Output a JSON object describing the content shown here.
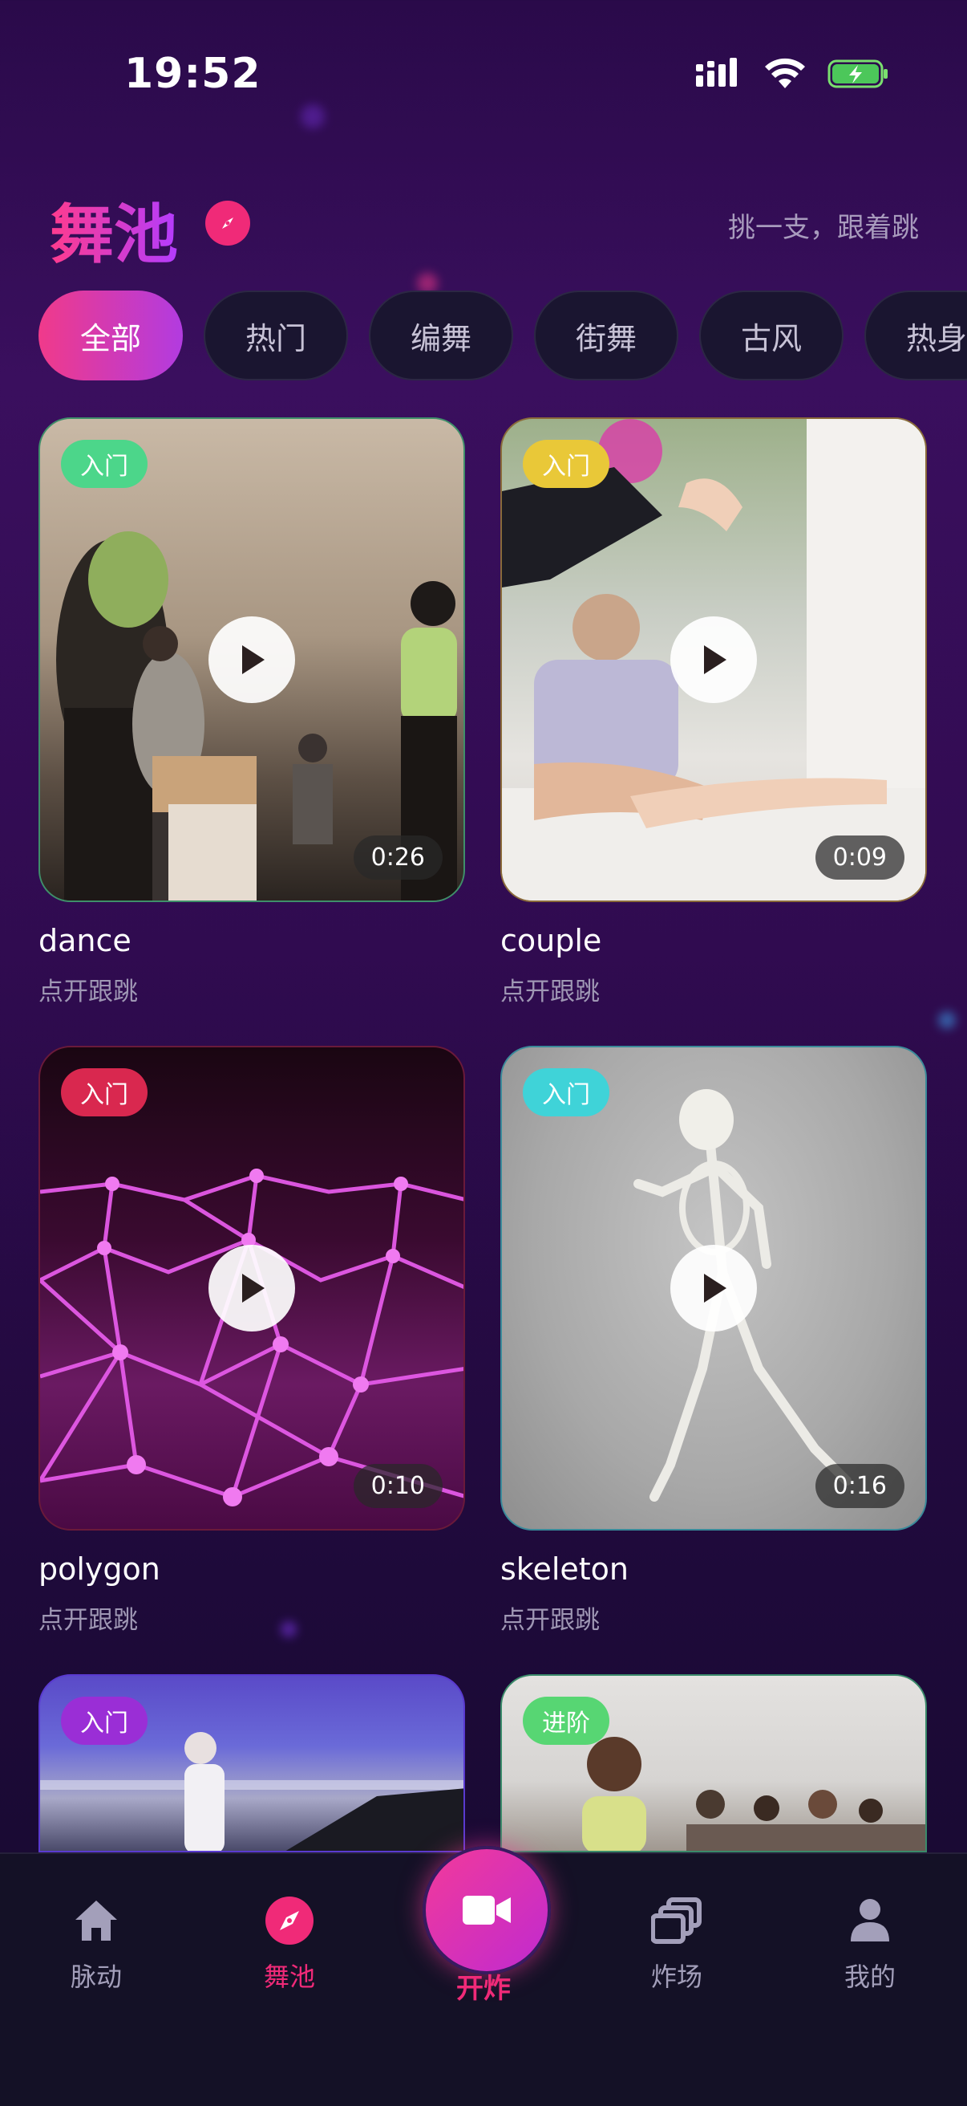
{
  "status_bar": {
    "time": "19:52"
  },
  "header": {
    "title": "舞池",
    "subtitle": "挑一支，跟着跳"
  },
  "chips": [
    "全部",
    "热门",
    "编舞",
    "街舞",
    "古风",
    "热身"
  ],
  "cards": [
    {
      "badge": "入门",
      "badge_color": "#4cd68a",
      "duration": "0:26",
      "title": "dance",
      "sub": "点开跟跳"
    },
    {
      "badge": "入门",
      "badge_color": "#e9c838",
      "duration": "0:09",
      "title": "couple",
      "sub": "点开跟跳"
    },
    {
      "badge": "入门",
      "badge_color": "#d9284f",
      "duration": "0:10",
      "title": "polygon",
      "sub": "点开跟跳"
    },
    {
      "badge": "入门",
      "badge_color": "#3fd3d8",
      "duration": "0:16",
      "title": "skeleton",
      "sub": "点开跟跳"
    },
    {
      "badge": "入门",
      "badge_color": "#9a2ed6",
      "duration": "",
      "title": "",
      "sub": ""
    },
    {
      "badge": "进阶",
      "badge_color": "#57d673",
      "duration": "",
      "title": "",
      "sub": ""
    }
  ],
  "nav": {
    "items": [
      {
        "label": "脉动",
        "icon": "home-icon"
      },
      {
        "label": "舞池",
        "icon": "compass-icon"
      },
      {
        "label": "开炸",
        "icon": "video-camera-icon"
      },
      {
        "label": "炸场",
        "icon": "gallery-icon"
      },
      {
        "label": "我的",
        "icon": "user-icon"
      }
    ]
  },
  "colors": {
    "accent": "#f02a78",
    "accent2": "#b23be0"
  }
}
